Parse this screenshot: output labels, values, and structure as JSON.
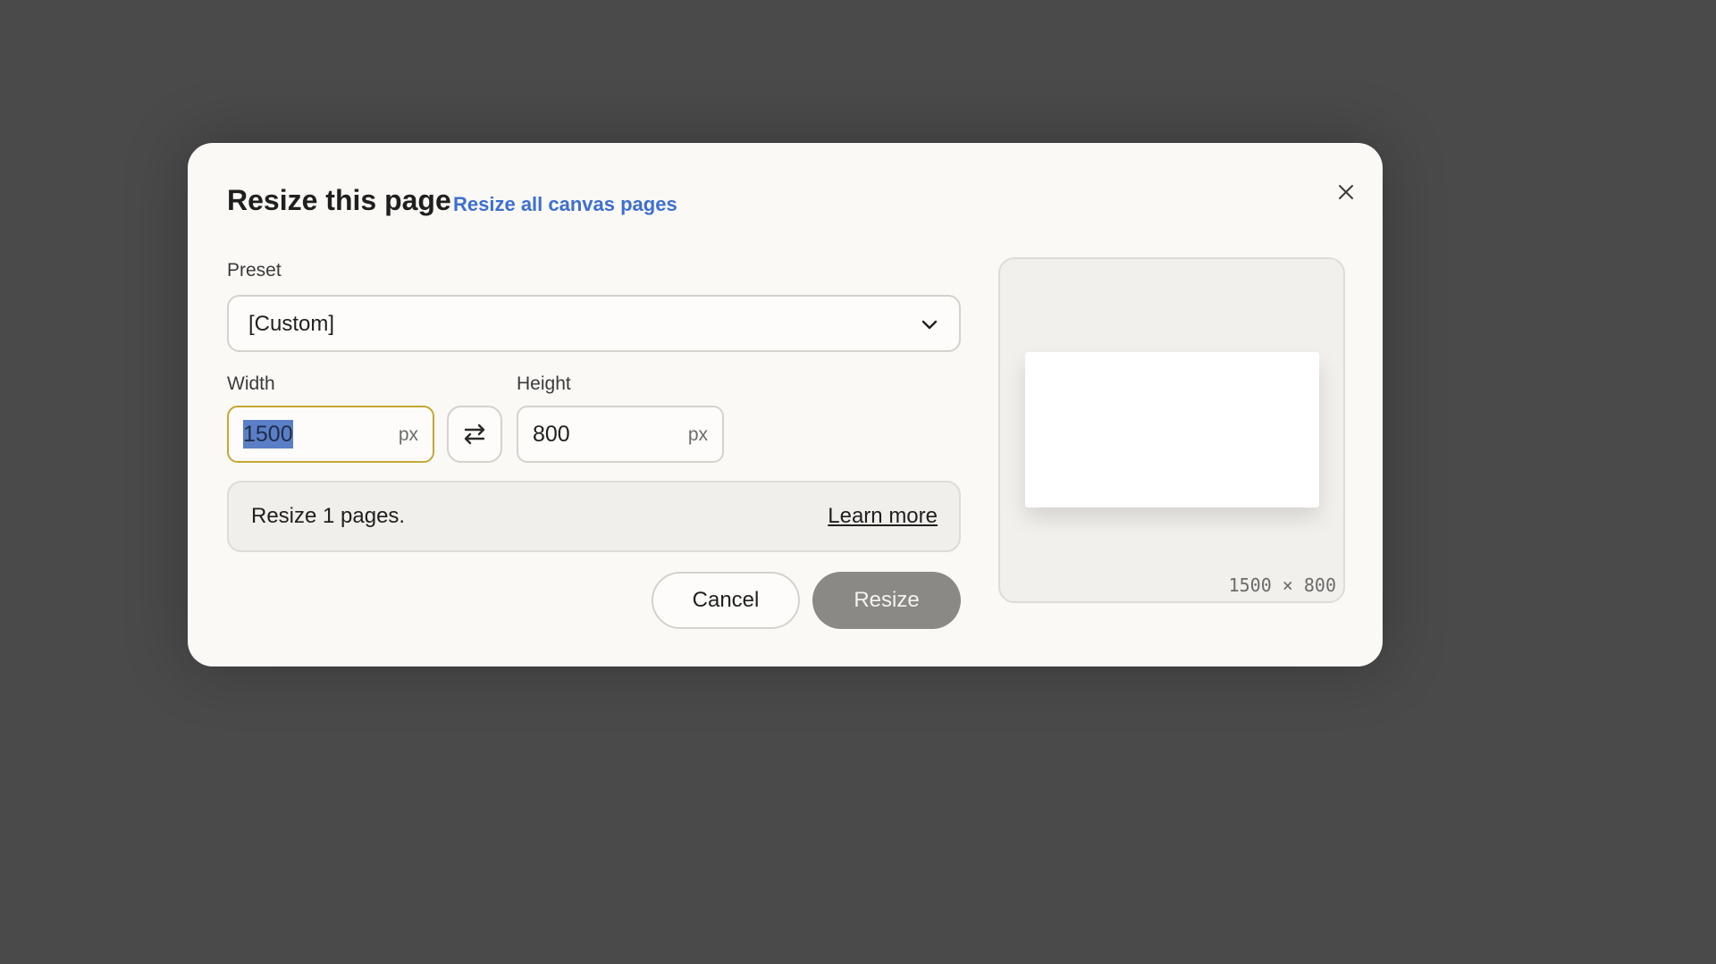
{
  "dialog": {
    "title": "Resize this page",
    "alt_link": "Resize all canvas pages",
    "close_icon": "close-icon"
  },
  "preset": {
    "label": "Preset",
    "value": "[Custom]",
    "chevron_icon": "chevron-down-icon"
  },
  "width": {
    "label": "Width",
    "value": "1500",
    "unit": "px",
    "selected": true
  },
  "swap": {
    "icon": "swap-arrows-icon"
  },
  "height": {
    "label": "Height",
    "value": "800",
    "unit": "px"
  },
  "info": {
    "text": "Resize 1 pages.",
    "link": "Learn more"
  },
  "buttons": {
    "cancel": "Cancel",
    "resize": "Resize"
  },
  "preview": {
    "dimensions": "1500 × 800"
  },
  "colors": {
    "backdrop": "#4a4a4a",
    "dialog_bg": "#faf9f6",
    "link": "#3d6fd0",
    "focus_border": "#c4a832",
    "resize_button": "#8a8986"
  }
}
